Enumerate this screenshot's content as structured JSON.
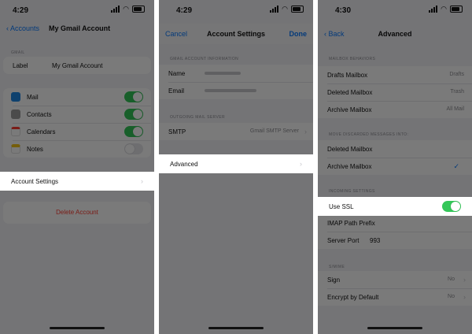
{
  "screen1": {
    "status_time": "4:29",
    "nav_back": "Accounts",
    "nav_title": "My Gmail Account",
    "section_label": "GMAIL",
    "label_row": {
      "label": "Label",
      "value": "My Gmail Account"
    },
    "apps": [
      {
        "label": "Mail",
        "icon": "mail-icon",
        "on": true,
        "color": "#1e88e5"
      },
      {
        "label": "Contacts",
        "icon": "contacts-icon",
        "on": true,
        "color": "#9e9e9e"
      },
      {
        "label": "Calendars",
        "icon": "calendar-icon",
        "on": true,
        "color": "#ffffff"
      },
      {
        "label": "Notes",
        "icon": "notes-icon",
        "on": false,
        "color": "#f5c518"
      }
    ],
    "account_settings": "Account Settings",
    "delete_account": "Delete Account"
  },
  "screen2": {
    "status_time": "4:29",
    "nav_left": "Cancel",
    "nav_title": "Account Settings",
    "nav_right": "Done",
    "section1_label": "GMAIL ACCOUNT INFORMATION",
    "rows1": [
      {
        "label": "Name"
      },
      {
        "label": "Email"
      }
    ],
    "section2_label": "OUTGOING MAIL SERVER",
    "smtp": {
      "label": "SMTP",
      "value": "Gmail SMTP Server"
    },
    "advanced": "Advanced"
  },
  "screen3": {
    "status_time": "4:30",
    "nav_back": "Back",
    "nav_title": "Advanced",
    "section1_label": "MAILBOX BEHAVIORS",
    "mailboxes": [
      {
        "label": "Drafts Mailbox",
        "value": "Drafts"
      },
      {
        "label": "Deleted Mailbox",
        "value": "Trash"
      },
      {
        "label": "Archive Mailbox",
        "value": "All Mail"
      }
    ],
    "section2_label": "MOVE DISCARDED MESSAGES INTO:",
    "discard": [
      {
        "label": "Deleted Mailbox",
        "checked": false
      },
      {
        "label": "Archive Mailbox",
        "checked": true
      }
    ],
    "section3_label": "INCOMING SETTINGS",
    "use_ssl": "Use SSL",
    "use_ssl_on": true,
    "imap_prefix": "IMAP Path Prefix",
    "server_port": {
      "label": "Server Port",
      "value": "993"
    },
    "section4_label": "S/MIME",
    "sign": {
      "label": "Sign",
      "value": "No"
    },
    "encrypt": {
      "label": "Encrypt by Default",
      "value": "No"
    }
  }
}
